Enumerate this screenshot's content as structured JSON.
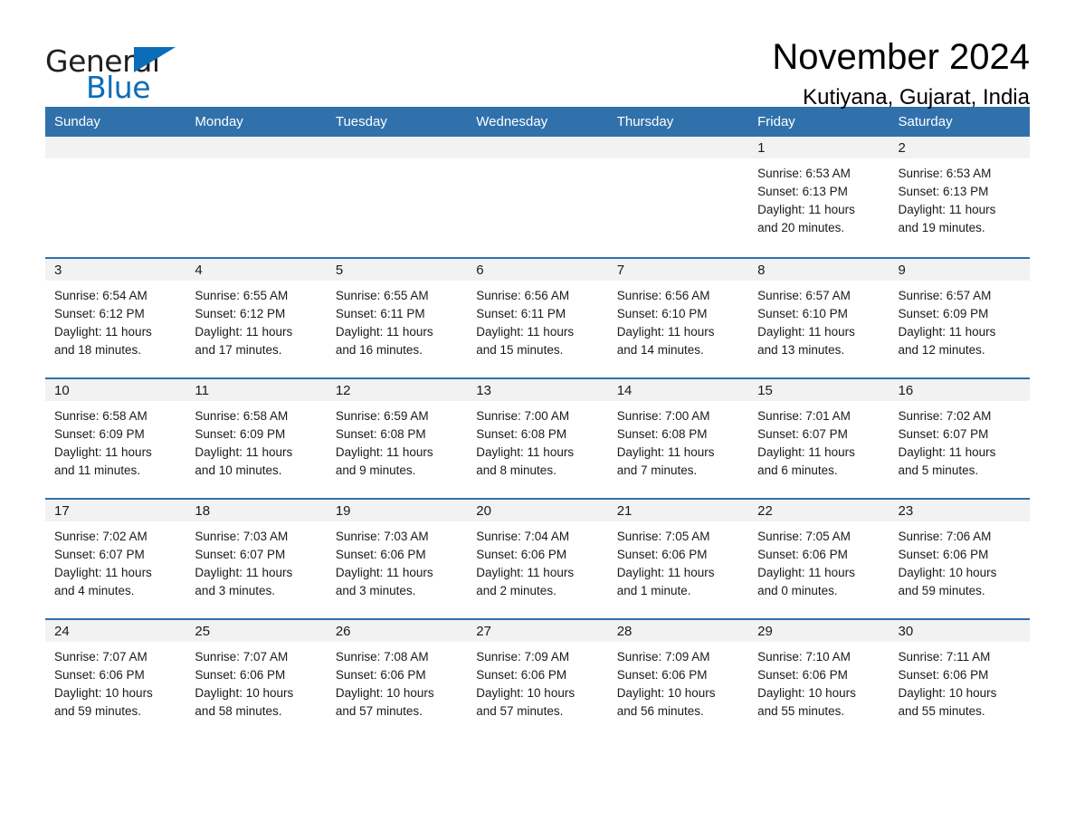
{
  "brand": {
    "name_part1": "General",
    "name_part2": "Blue",
    "accent_color": "#0b6cb7"
  },
  "header": {
    "month_title": "November 2024",
    "location": "Kutiyana, Gujarat, India",
    "header_bg_color": "#3071ac",
    "daystrip_bg_color": "#f2f2f2"
  },
  "weekday_headers": [
    "Sunday",
    "Monday",
    "Tuesday",
    "Wednesday",
    "Thursday",
    "Friday",
    "Saturday"
  ],
  "labels": {
    "sunrise_prefix": "Sunrise:",
    "sunset_prefix": "Sunset:",
    "daylight_prefix": "Daylight:"
  },
  "weeks": [
    [
      {
        "day": "",
        "blank": true
      },
      {
        "day": "",
        "blank": true
      },
      {
        "day": "",
        "blank": true
      },
      {
        "day": "",
        "blank": true
      },
      {
        "day": "",
        "blank": true
      },
      {
        "day": "1",
        "sunrise": "Sunrise: 6:53 AM",
        "sunset": "Sunset: 6:13 PM",
        "daylight_line1": "Daylight: 11 hours",
        "daylight_line2": "and 20 minutes."
      },
      {
        "day": "2",
        "sunrise": "Sunrise: 6:53 AM",
        "sunset": "Sunset: 6:13 PM",
        "daylight_line1": "Daylight: 11 hours",
        "daylight_line2": "and 19 minutes."
      }
    ],
    [
      {
        "day": "3",
        "sunrise": "Sunrise: 6:54 AM",
        "sunset": "Sunset: 6:12 PM",
        "daylight_line1": "Daylight: 11 hours",
        "daylight_line2": "and 18 minutes."
      },
      {
        "day": "4",
        "sunrise": "Sunrise: 6:55 AM",
        "sunset": "Sunset: 6:12 PM",
        "daylight_line1": "Daylight: 11 hours",
        "daylight_line2": "and 17 minutes."
      },
      {
        "day": "5",
        "sunrise": "Sunrise: 6:55 AM",
        "sunset": "Sunset: 6:11 PM",
        "daylight_line1": "Daylight: 11 hours",
        "daylight_line2": "and 16 minutes."
      },
      {
        "day": "6",
        "sunrise": "Sunrise: 6:56 AM",
        "sunset": "Sunset: 6:11 PM",
        "daylight_line1": "Daylight: 11 hours",
        "daylight_line2": "and 15 minutes."
      },
      {
        "day": "7",
        "sunrise": "Sunrise: 6:56 AM",
        "sunset": "Sunset: 6:10 PM",
        "daylight_line1": "Daylight: 11 hours",
        "daylight_line2": "and 14 minutes."
      },
      {
        "day": "8",
        "sunrise": "Sunrise: 6:57 AM",
        "sunset": "Sunset: 6:10 PM",
        "daylight_line1": "Daylight: 11 hours",
        "daylight_line2": "and 13 minutes."
      },
      {
        "day": "9",
        "sunrise": "Sunrise: 6:57 AM",
        "sunset": "Sunset: 6:09 PM",
        "daylight_line1": "Daylight: 11 hours",
        "daylight_line2": "and 12 minutes."
      }
    ],
    [
      {
        "day": "10",
        "sunrise": "Sunrise: 6:58 AM",
        "sunset": "Sunset: 6:09 PM",
        "daylight_line1": "Daylight: 11 hours",
        "daylight_line2": "and 11 minutes."
      },
      {
        "day": "11",
        "sunrise": "Sunrise: 6:58 AM",
        "sunset": "Sunset: 6:09 PM",
        "daylight_line1": "Daylight: 11 hours",
        "daylight_line2": "and 10 minutes."
      },
      {
        "day": "12",
        "sunrise": "Sunrise: 6:59 AM",
        "sunset": "Sunset: 6:08 PM",
        "daylight_line1": "Daylight: 11 hours",
        "daylight_line2": "and 9 minutes."
      },
      {
        "day": "13",
        "sunrise": "Sunrise: 7:00 AM",
        "sunset": "Sunset: 6:08 PM",
        "daylight_line1": "Daylight: 11 hours",
        "daylight_line2": "and 8 minutes."
      },
      {
        "day": "14",
        "sunrise": "Sunrise: 7:00 AM",
        "sunset": "Sunset: 6:08 PM",
        "daylight_line1": "Daylight: 11 hours",
        "daylight_line2": "and 7 minutes."
      },
      {
        "day": "15",
        "sunrise": "Sunrise: 7:01 AM",
        "sunset": "Sunset: 6:07 PM",
        "daylight_line1": "Daylight: 11 hours",
        "daylight_line2": "and 6 minutes."
      },
      {
        "day": "16",
        "sunrise": "Sunrise: 7:02 AM",
        "sunset": "Sunset: 6:07 PM",
        "daylight_line1": "Daylight: 11 hours",
        "daylight_line2": "and 5 minutes."
      }
    ],
    [
      {
        "day": "17",
        "sunrise": "Sunrise: 7:02 AM",
        "sunset": "Sunset: 6:07 PM",
        "daylight_line1": "Daylight: 11 hours",
        "daylight_line2": "and 4 minutes."
      },
      {
        "day": "18",
        "sunrise": "Sunrise: 7:03 AM",
        "sunset": "Sunset: 6:07 PM",
        "daylight_line1": "Daylight: 11 hours",
        "daylight_line2": "and 3 minutes."
      },
      {
        "day": "19",
        "sunrise": "Sunrise: 7:03 AM",
        "sunset": "Sunset: 6:06 PM",
        "daylight_line1": "Daylight: 11 hours",
        "daylight_line2": "and 3 minutes."
      },
      {
        "day": "20",
        "sunrise": "Sunrise: 7:04 AM",
        "sunset": "Sunset: 6:06 PM",
        "daylight_line1": "Daylight: 11 hours",
        "daylight_line2": "and 2 minutes."
      },
      {
        "day": "21",
        "sunrise": "Sunrise: 7:05 AM",
        "sunset": "Sunset: 6:06 PM",
        "daylight_line1": "Daylight: 11 hours",
        "daylight_line2": "and 1 minute."
      },
      {
        "day": "22",
        "sunrise": "Sunrise: 7:05 AM",
        "sunset": "Sunset: 6:06 PM",
        "daylight_line1": "Daylight: 11 hours",
        "daylight_line2": "and 0 minutes."
      },
      {
        "day": "23",
        "sunrise": "Sunrise: 7:06 AM",
        "sunset": "Sunset: 6:06 PM",
        "daylight_line1": "Daylight: 10 hours",
        "daylight_line2": "and 59 minutes."
      }
    ],
    [
      {
        "day": "24",
        "sunrise": "Sunrise: 7:07 AM",
        "sunset": "Sunset: 6:06 PM",
        "daylight_line1": "Daylight: 10 hours",
        "daylight_line2": "and 59 minutes."
      },
      {
        "day": "25",
        "sunrise": "Sunrise: 7:07 AM",
        "sunset": "Sunset: 6:06 PM",
        "daylight_line1": "Daylight: 10 hours",
        "daylight_line2": "and 58 minutes."
      },
      {
        "day": "26",
        "sunrise": "Sunrise: 7:08 AM",
        "sunset": "Sunset: 6:06 PM",
        "daylight_line1": "Daylight: 10 hours",
        "daylight_line2": "and 57 minutes."
      },
      {
        "day": "27",
        "sunrise": "Sunrise: 7:09 AM",
        "sunset": "Sunset: 6:06 PM",
        "daylight_line1": "Daylight: 10 hours",
        "daylight_line2": "and 57 minutes."
      },
      {
        "day": "28",
        "sunrise": "Sunrise: 7:09 AM",
        "sunset": "Sunset: 6:06 PM",
        "daylight_line1": "Daylight: 10 hours",
        "daylight_line2": "and 56 minutes."
      },
      {
        "day": "29",
        "sunrise": "Sunrise: 7:10 AM",
        "sunset": "Sunset: 6:06 PM",
        "daylight_line1": "Daylight: 10 hours",
        "daylight_line2": "and 55 minutes."
      },
      {
        "day": "30",
        "sunrise": "Sunrise: 7:11 AM",
        "sunset": "Sunset: 6:06 PM",
        "daylight_line1": "Daylight: 10 hours",
        "daylight_line2": "and 55 minutes."
      }
    ]
  ]
}
